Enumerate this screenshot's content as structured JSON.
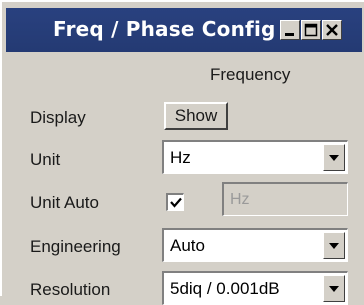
{
  "window": {
    "title": "Freq / Phase Config",
    "controls": {
      "minimize": "minimize-icon",
      "maximize": "maximize-icon",
      "close": "close-icon"
    }
  },
  "header": {
    "column": "Frequency"
  },
  "rows": {
    "display": {
      "label": "Display",
      "button_label": "Show"
    },
    "unit": {
      "label": "Unit",
      "value": "Hz"
    },
    "unit_auto": {
      "label": "Unit Auto",
      "checked": true,
      "field_value": "Hz"
    },
    "engineering": {
      "label": "Engineering",
      "value": "Auto"
    },
    "resolution": {
      "label": "Resolution",
      "value": "5diq / 0.001dB"
    }
  },
  "colors": {
    "titlebar": "#29417f",
    "panel": "#d4d0c8"
  }
}
